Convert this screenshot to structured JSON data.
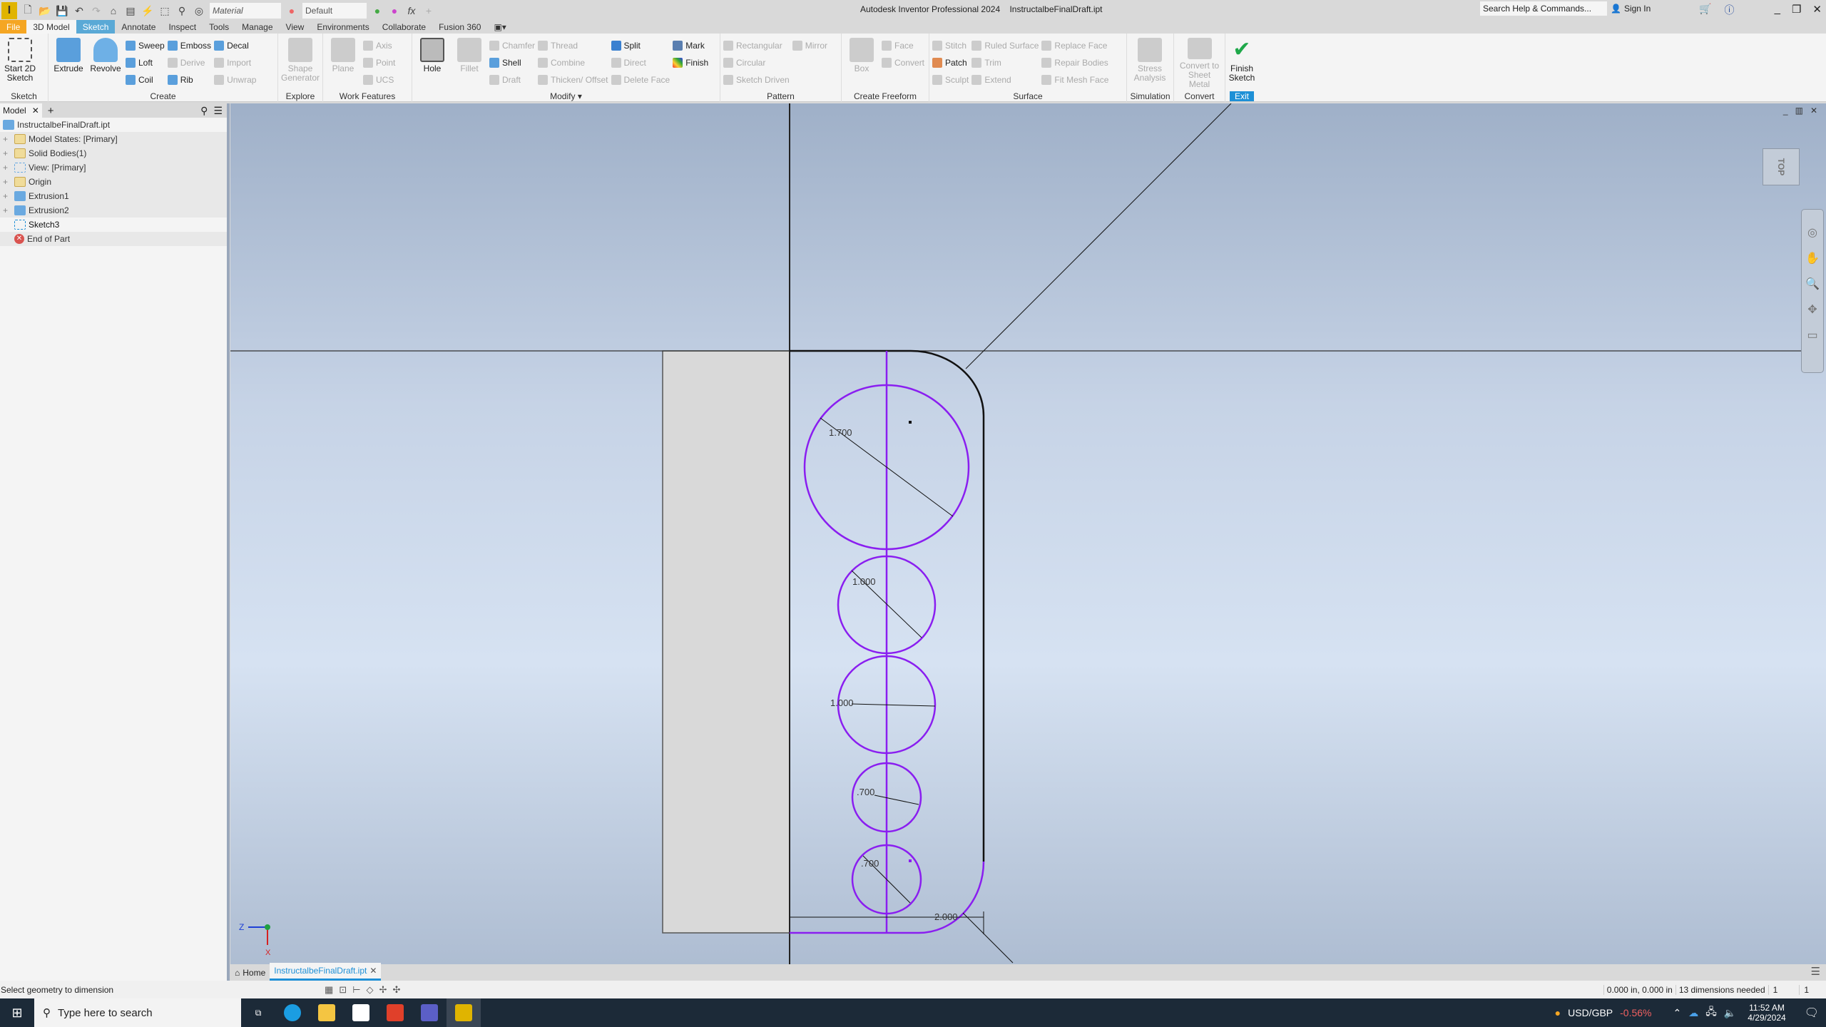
{
  "titlebar": {
    "app_title": "Autodesk Inventor Professional 2024    InstructalbeFinalDraft.ipt",
    "material": "Material",
    "appearance": "Default",
    "search_placeholder": "Search Help & Commands...",
    "sign_in": "Sign In"
  },
  "tabs": [
    "File",
    "3D Model",
    "Sketch",
    "Annotate",
    "Inspect",
    "Tools",
    "Manage",
    "View",
    "Environments",
    "Collaborate",
    "Fusion 360"
  ],
  "ribbon": {
    "sketch": {
      "label": "Sketch",
      "start": "Start 2D Sketch"
    },
    "create": {
      "label": "Create",
      "extrude": "Extrude",
      "revolve": "Revolve",
      "sweep": "Sweep",
      "loft": "Loft",
      "coil": "Coil",
      "emboss": "Emboss",
      "derive": "Derive",
      "rib": "Rib",
      "decal": "Decal",
      "import": "Import",
      "unwrap": "Unwrap"
    },
    "explore": {
      "label": "Explore",
      "shape": "Shape Generator"
    },
    "work": {
      "label": "Work Features",
      "plane": "Plane",
      "axis": "Axis",
      "point": "Point",
      "ucs": "UCS"
    },
    "modify": {
      "label": "Modify",
      "hole": "Hole",
      "fillet": "Fillet",
      "chamfer": "Chamfer",
      "shell": "Shell",
      "draft": "Draft",
      "thread": "Thread",
      "combine": "Combine",
      "thicken": "Thicken/ Offset",
      "split": "Split",
      "direct": "Direct",
      "delete_face": "Delete Face",
      "mark": "Mark",
      "finish": "Finish"
    },
    "pattern": {
      "label": "Pattern",
      "rectangular": "Rectangular",
      "circular": "Circular",
      "sketch_driven": "Sketch Driven",
      "mirror": "Mirror"
    },
    "freeform": {
      "label": "Create Freeform",
      "box": "Box",
      "face": "Face",
      "convert": "Convert"
    },
    "surface": {
      "label": "Surface",
      "stitch": "Stitch",
      "patch": "Patch",
      "sculpt": "Sculpt",
      "ruled": "Ruled Surface",
      "trim": "Trim",
      "extend": "Extend",
      "replace": "Replace Face",
      "repair": "Repair Bodies",
      "fitmesh": "Fit Mesh Face"
    },
    "simulation": {
      "label": "Simulation",
      "stress": "Stress Analysis"
    },
    "convert": {
      "label": "Convert",
      "sheet": "Convert to Sheet Metal"
    },
    "exit": {
      "label": "Exit",
      "finish": "Finish Sketch"
    }
  },
  "browser": {
    "tab": "Model",
    "nodes": [
      "InstructalbeFinalDraft.ipt",
      "Model States: [Primary]",
      "Solid Bodies(1)",
      "View: [Primary]",
      "Origin",
      "Extrusion1",
      "Extrusion2",
      "Sketch3",
      "End of Part"
    ]
  },
  "viewport": {
    "viewcube": "TOP",
    "dims": {
      "d1": "1.700",
      "d2": "1.000",
      "d3": "1.000",
      "d4": ".700",
      "d5": ".700",
      "width": "2.000"
    },
    "sketch_color": "#8a1ef0",
    "axes": {
      "z": "Z",
      "x": "X"
    }
  },
  "doctabs": {
    "home": "Home",
    "file": "InstructalbeFinalDraft.ipt"
  },
  "status": {
    "prompt": "Select geometry to dimension",
    "coords": "0.000 in, 0.000 in",
    "needed": "13 dimensions needed",
    "a": "1",
    "b": "1"
  },
  "taskbar": {
    "search": "Type here to search",
    "ticker": "USD/GBP",
    "change": "-0.56%",
    "time": "11:52 AM",
    "date": "4/29/2024"
  }
}
